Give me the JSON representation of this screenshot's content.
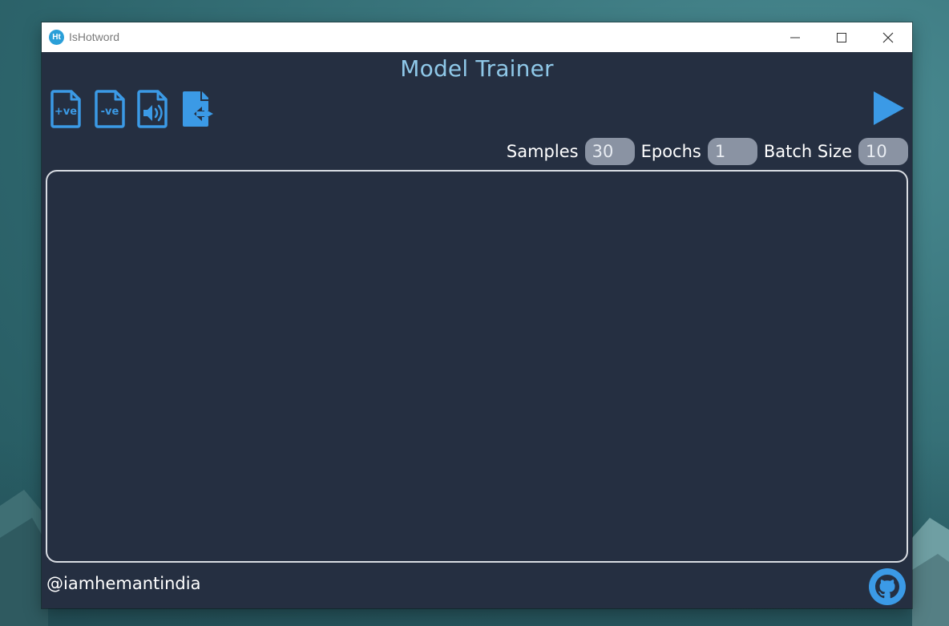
{
  "window": {
    "title": "IsHotword",
    "app_icon_text": "Ht"
  },
  "app": {
    "heading": "Model Trainer"
  },
  "toolbar": {
    "icons": [
      "file-positive-icon",
      "file-negative-icon",
      "audio-file-icon",
      "file-export-icon"
    ],
    "positive_label": "+ve",
    "negative_label": "-ve",
    "run": "play-icon"
  },
  "params": {
    "samples_label": "Samples",
    "samples_value": "30",
    "epochs_label": "Epochs",
    "epochs_value": "1",
    "batch_label": "Batch Size",
    "batch_value": "10"
  },
  "footer": {
    "handle": "@iamhemantindia",
    "github": "github-icon"
  },
  "colors": {
    "window_bg": "#252f41",
    "accent": "#3b9ae6",
    "heading": "#8fc8e8",
    "input_bg": "#8a93a3"
  }
}
